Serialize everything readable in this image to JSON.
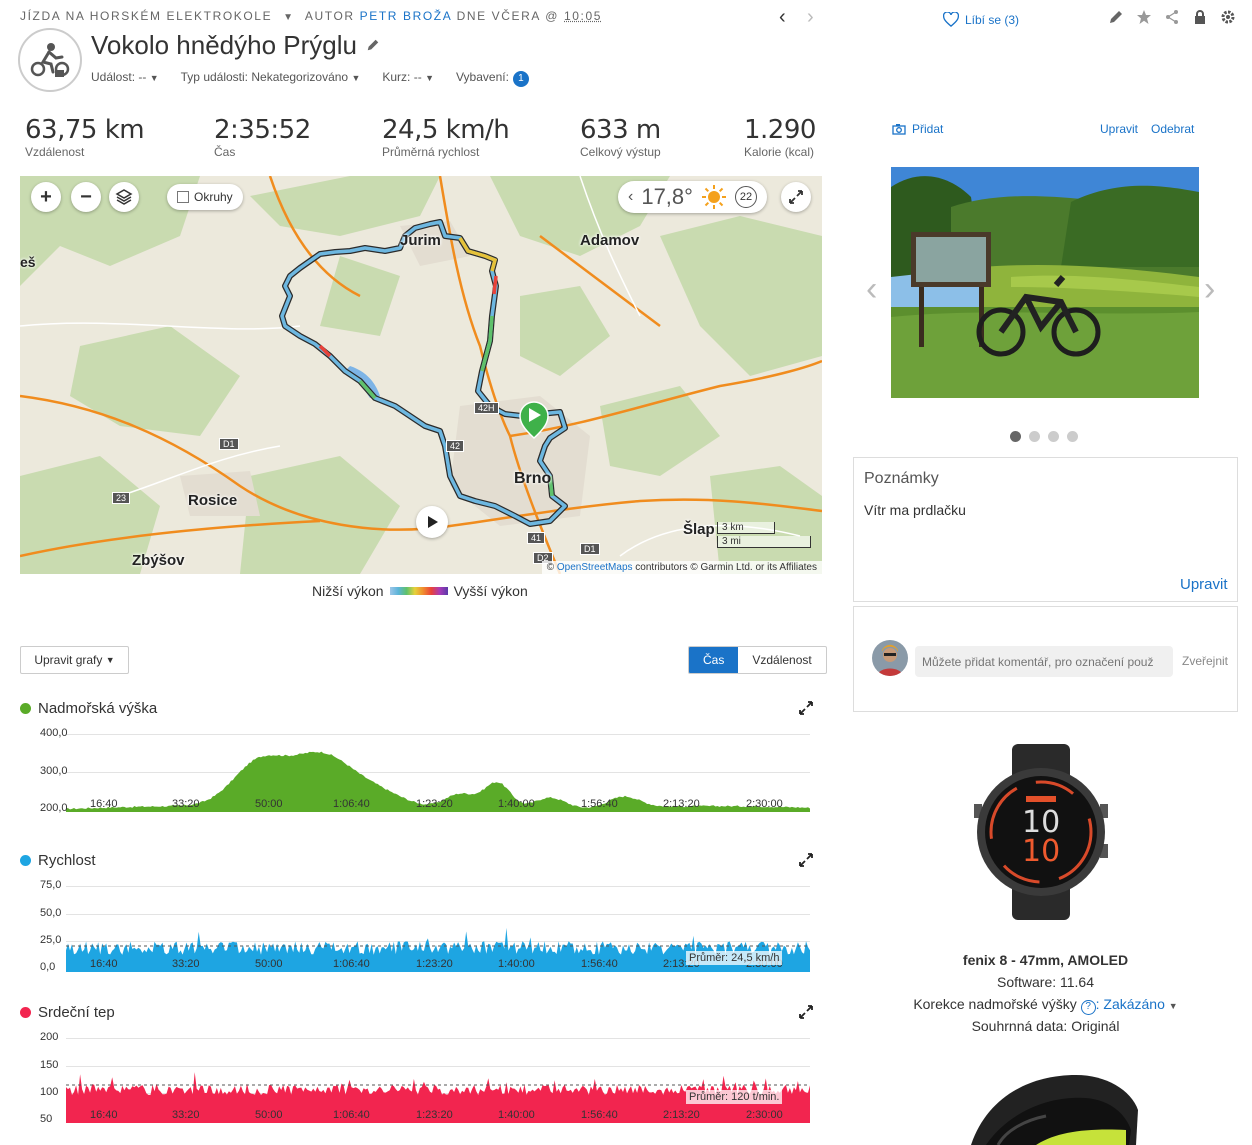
{
  "header": {
    "activity_type": "JÍZDA NA HORSKÉM ELEKTROKOLE",
    "author_prefix": "AUTOR",
    "author": "PETR BROŽA",
    "date_prefix": "DNE VČERA @",
    "time": "10:05",
    "like_label": "Líbí se (3)"
  },
  "activity": {
    "title": "Vokolo hnědýho Prýglu",
    "meta": [
      {
        "label": "Událost:",
        "value": "--"
      },
      {
        "label": "Typ události:",
        "value": "Nekategorizováno"
      },
      {
        "label": "Kurz:",
        "value": "--"
      },
      {
        "label": "Vybavení:",
        "value": "1"
      }
    ]
  },
  "stats": [
    {
      "value": "63,75 km",
      "label": "Vzdálenost"
    },
    {
      "value": "2:35:52",
      "label": "Čas"
    },
    {
      "value": "24,5 km/h",
      "label": "Průměrná rychlost"
    },
    {
      "value": "633 m",
      "label": "Celkový výstup"
    },
    {
      "value": "1.290",
      "label": "Kalorie (kcal)"
    }
  ],
  "map": {
    "okruhy_label": "Okruhy",
    "temperature": "17,8°",
    "wind": "22",
    "towns": [
      "Jurim",
      "Adamov",
      "Brno",
      "Rosice",
      "Zbýšov",
      "Šlap",
      "eš"
    ],
    "roads": [
      "D1",
      "23",
      "42",
      "42H",
      "41",
      "D2",
      "D1"
    ],
    "scale": [
      "3 km",
      "3 mi"
    ],
    "attribution_prefix": "©",
    "attribution_link": "OpenStreetMaps",
    "attribution_suffix": "contributors © Garmin Ltd. or its Affiliates",
    "legend_low": "Nižší výkon",
    "legend_high": "Vyšší výkon"
  },
  "charts_controls": {
    "edit_label": "Upravit grafy",
    "toggle": [
      "Čas",
      "Vzdálenost"
    ],
    "active": "Čas"
  },
  "charts": [
    {
      "title": "Nadmořská výška",
      "color": "#5aab28",
      "y_ticks": [
        "400,0",
        "300,0",
        "200,0"
      ],
      "x_ticks": [
        "16:40",
        "33:20",
        "50:00",
        "1:06:40",
        "1:23:20",
        "1:40:00",
        "1:56:40",
        "2:13:20",
        "2:30:00"
      ],
      "avg_label": ""
    },
    {
      "title": "Rychlost",
      "color": "#1ea5e2",
      "y_ticks": [
        "75,0",
        "50,0",
        "25,0",
        "0,0"
      ],
      "x_ticks": [
        "16:40",
        "33:20",
        "50:00",
        "1:06:40",
        "1:23:20",
        "1:40:00",
        "1:56:40",
        "2:13:20",
        "2:30:00"
      ],
      "avg_label": "Průměr: 24,5 km/h"
    },
    {
      "title": "Srdeční tep",
      "color": "#f2254f",
      "y_ticks": [
        "200",
        "150",
        "100",
        "50"
      ],
      "x_ticks": [
        "16:40",
        "33:20",
        "50:00",
        "1:06:40",
        "1:23:20",
        "1:40:00",
        "1:56:40",
        "2:13:20",
        "2:30:00"
      ],
      "avg_label": "Průměr: 120 t/min."
    }
  ],
  "photos": {
    "add_label": "Přidat",
    "edit_label": "Upravit",
    "remove_label": "Odebrat",
    "count": 4,
    "active": 0
  },
  "notes": {
    "title": "Poznámky",
    "text": "Vítr ma prdlačku",
    "edit_label": "Upravit"
  },
  "comment": {
    "placeholder": "Můžete přidat komentář, pro označení použ",
    "publish_label": "Zveřejnit"
  },
  "device": {
    "name": "fenix 8 - 47mm, AMOLED",
    "software": "Software: 11.64",
    "elev_label": "Korekce nadmořské výšky",
    "elev_value": "Zakázáno",
    "summary": "Souhrnná data: Originál",
    "watch_time_h": "10",
    "watch_time_m": "10"
  }
}
